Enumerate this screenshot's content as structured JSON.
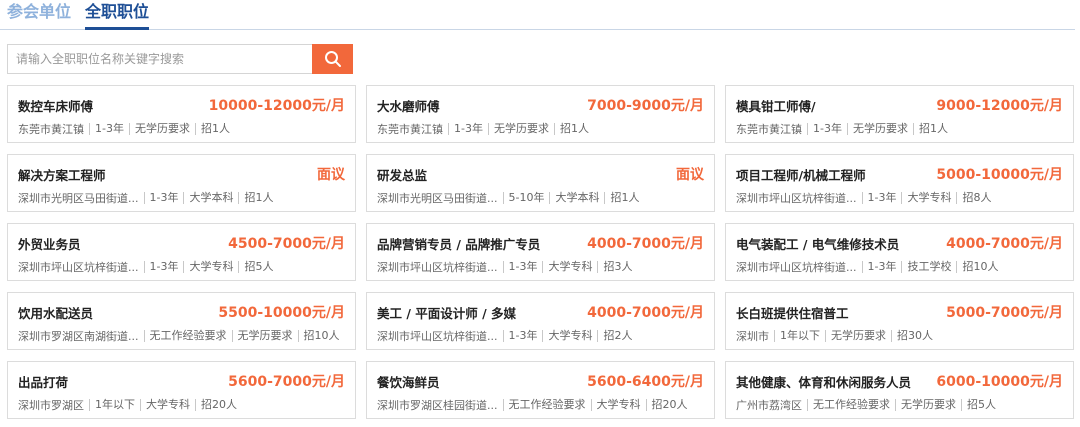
{
  "tabs": [
    {
      "label": "参会单位",
      "active": false
    },
    {
      "label": "全职职位",
      "active": true
    }
  ],
  "search": {
    "placeholder": "请输入全职职位名称关键字搜索",
    "button_icon": "search-icon"
  },
  "colors": {
    "accent": "#f2683b",
    "tab_active": "#1e4f96",
    "tab_inactive": "#8fb2dc"
  },
  "jobs": [
    {
      "title": "数控车床师傅",
      "salary": "10000-12000元/月",
      "location": "东莞市黄江镇",
      "experience": "1-3年",
      "education": "无学历要求",
      "headcount": "招1人"
    },
    {
      "title": "大水磨师傅",
      "salary": "7000-9000元/月",
      "location": "东莞市黄江镇",
      "experience": "1-3年",
      "education": "无学历要求",
      "headcount": "招1人"
    },
    {
      "title": "模具钳工师傅/",
      "salary": "9000-12000元/月",
      "location": "东莞市黄江镇",
      "experience": "1-3年",
      "education": "无学历要求",
      "headcount": "招1人"
    },
    {
      "title": "解决方案工程师",
      "salary": "面议",
      "location": "深圳市光明区马田街道...",
      "experience": "1-3年",
      "education": "大学本科",
      "headcount": "招1人"
    },
    {
      "title": "研发总监",
      "salary": "面议",
      "location": "深圳市光明区马田街道...",
      "experience": "5-10年",
      "education": "大学本科",
      "headcount": "招1人"
    },
    {
      "title": "项目工程师/机械工程师",
      "salary": "5000-10000元/月",
      "location": "深圳市坪山区坑梓街道...",
      "experience": "1-3年",
      "education": "大学专科",
      "headcount": "招8人"
    },
    {
      "title": "外贸业务员",
      "salary": "4500-7000元/月",
      "location": "深圳市坪山区坑梓街道...",
      "experience": "1-3年",
      "education": "大学专科",
      "headcount": "招5人"
    },
    {
      "title": "品牌营销专员 / 品牌推广专员",
      "salary": "4000-7000元/月",
      "location": "深圳市坪山区坑梓街道...",
      "experience": "1-3年",
      "education": "大学专科",
      "headcount": "招3人"
    },
    {
      "title": "电气装配工 / 电气维修技术员",
      "salary": "4000-7000元/月",
      "location": "深圳市坪山区坑梓街道...",
      "experience": "1-3年",
      "education": "技工学校",
      "headcount": "招10人"
    },
    {
      "title": "饮用水配送员",
      "salary": "5500-10000元/月",
      "location": "深圳市罗湖区南湖街道...",
      "experience": "无工作经验要求",
      "education": "无学历要求",
      "headcount": "招10人"
    },
    {
      "title": "美工 / 平面设计师 / 多媒",
      "salary": "4000-7000元/月",
      "location": "深圳市坪山区坑梓街道...",
      "experience": "1-3年",
      "education": "大学专科",
      "headcount": "招2人"
    },
    {
      "title": "长白班提供住宿普工",
      "salary": "5000-7000元/月",
      "location": "深圳市",
      "experience": "1年以下",
      "education": "无学历要求",
      "headcount": "招30人"
    },
    {
      "title": "出品打荷",
      "salary": "5600-7000元/月",
      "location": "深圳市罗湖区",
      "experience": "1年以下",
      "education": "大学专科",
      "headcount": "招20人"
    },
    {
      "title": "餐饮海鲜员",
      "salary": "5600-6400元/月",
      "location": "深圳市罗湖区桂园街道...",
      "experience": "无工作经验要求",
      "education": "大学专科",
      "headcount": "招20人"
    },
    {
      "title": "其他健康、体育和休闲服务人员",
      "salary": "6000-10000元/月",
      "location": "广州市荔湾区",
      "experience": "无工作经验要求",
      "education": "无学历要求",
      "headcount": "招5人"
    }
  ]
}
